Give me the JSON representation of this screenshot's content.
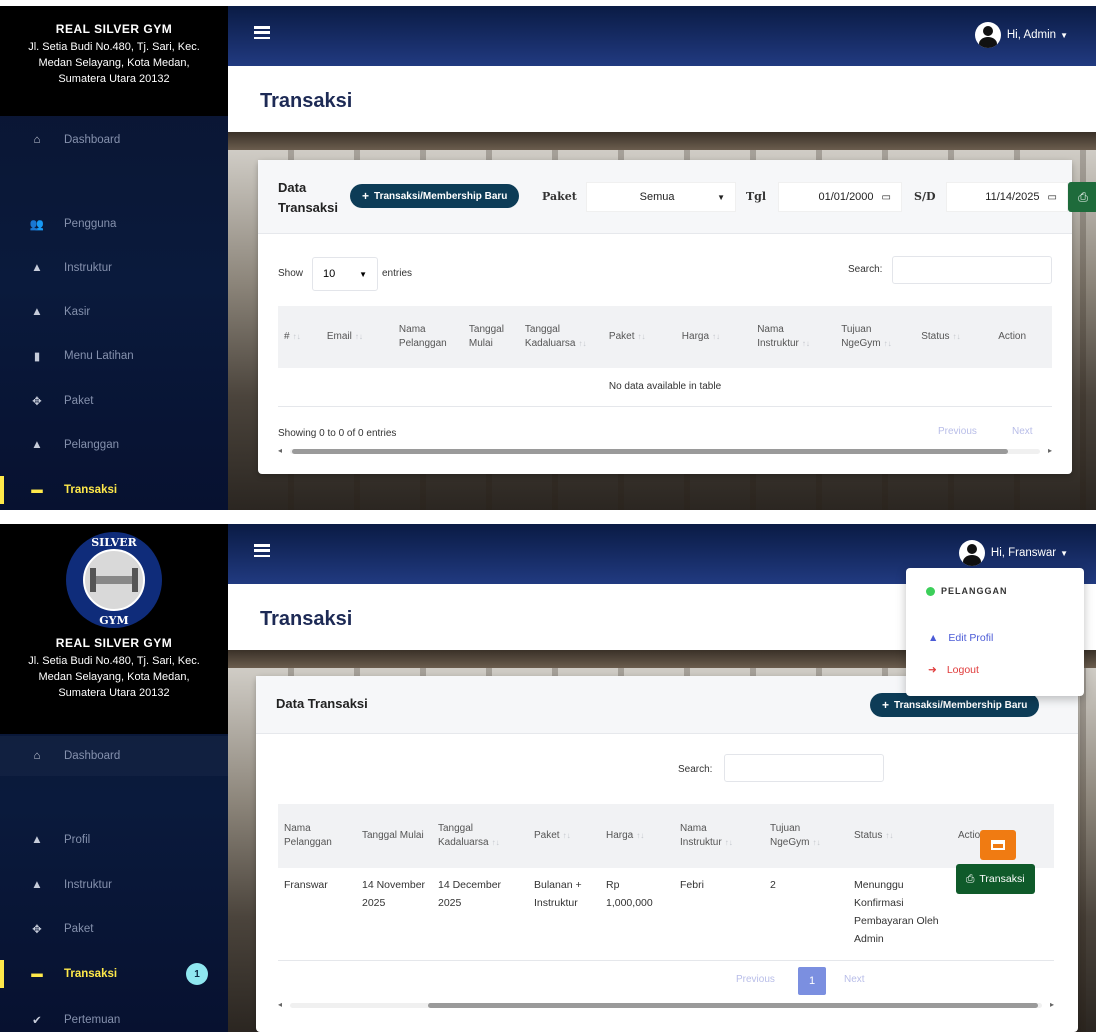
{
  "brand": {
    "name": "REAL SILVER GYM",
    "address_line1": "Jl. Setia Budi No.480, Tj. Sari, Kec.",
    "address_line2": "Medan Selayang, Kota Medan,",
    "address_line3": "Sumatera Utara 20132",
    "logo_text_top": "SILVER",
    "logo_text_bottom": "GYM"
  },
  "admin_view": {
    "sidebar": [
      {
        "label": "Dashboard",
        "icon": "home-icon"
      },
      {
        "label": "Pengguna",
        "icon": "users-icon"
      },
      {
        "label": "Instruktur",
        "icon": "user-icon"
      },
      {
        "label": "Kasir",
        "icon": "user-icon"
      },
      {
        "label": "Menu Latihan",
        "icon": "bookmark-icon"
      },
      {
        "label": "Paket",
        "icon": "move-icon"
      },
      {
        "label": "Pelanggan",
        "icon": "user-icon"
      },
      {
        "label": "Transaksi",
        "icon": "card-icon",
        "active": true
      }
    ],
    "user_greeting": "Hi, Admin",
    "page_title": "Transaksi",
    "card_title_line1": "Data",
    "card_title_line2": "Transaksi",
    "new_button": "Transaksi/Membership Baru",
    "filter_paket_label": "Paket",
    "filter_paket_value": "Semua",
    "filter_tgl_label": "Tgl",
    "date_from": "01/01/2000",
    "sd_label": "S/D",
    "date_to": "11/14/2025",
    "show_label": "Show",
    "entries_value": "10",
    "entries_label": "entries",
    "search_label": "Search:",
    "columns": [
      "#",
      "Email",
      "Nama Pelanggan",
      "Tanggal Mulai",
      "Tanggal Kadaluarsa",
      "Paket",
      "Harga",
      "Nama Instruktur",
      "Tujuan NgeGym",
      "Status",
      "Action"
    ],
    "empty_message": "No data available in table",
    "info": "Showing 0 to 0 of 0 entries",
    "prev": "Previous",
    "next": "Next"
  },
  "member_view": {
    "sidebar": [
      {
        "label": "Dashboard",
        "icon": "home-icon"
      },
      {
        "label": "Profil",
        "icon": "user-icon"
      },
      {
        "label": "Instruktur",
        "icon": "user-icon"
      },
      {
        "label": "Paket",
        "icon": "move-icon"
      },
      {
        "label": "Transaksi",
        "icon": "card-icon",
        "active": true,
        "badge": "1"
      },
      {
        "label": "Pertemuan",
        "icon": "check-icon"
      }
    ],
    "user_greeting": "Hi, Franswar",
    "page_title": "Transaksi",
    "dropdown": {
      "role": "PELANGGAN",
      "edit_profile": "Edit Profil",
      "logout": "Logout"
    },
    "card_title": "Data Transaksi",
    "new_button": "Transaksi/Membership Baru",
    "search_label": "Search:",
    "columns": [
      "Nama Pelanggan",
      "Tanggal Mulai",
      "Tanggal Kadaluarsa",
      "Paket",
      "Harga",
      "Nama Instruktur",
      "Tujuan NgeGym",
      "Status",
      "Action"
    ],
    "row": {
      "nama": "Franswar",
      "mulai": "14 November 2025",
      "kadaluarsa": "14 December 2025",
      "paket": "Bulanan + Instruktur",
      "harga": "Rp 1,000,000",
      "instruktur": "Febri",
      "tujuan": "2",
      "status": "Menunggu Konfirmasi Pembayaran Oleh Admin",
      "action_button": "Transaksi"
    },
    "prev": "Previous",
    "page": "1",
    "next": "Next"
  },
  "colors": {
    "sidebar_bg": "#0b1430",
    "topbar": "#0a1b44",
    "active": "#ffe94a",
    "primary_button": "#0d3c57",
    "print_button": "#1e6b3b",
    "orange_button": "#f07b12"
  }
}
